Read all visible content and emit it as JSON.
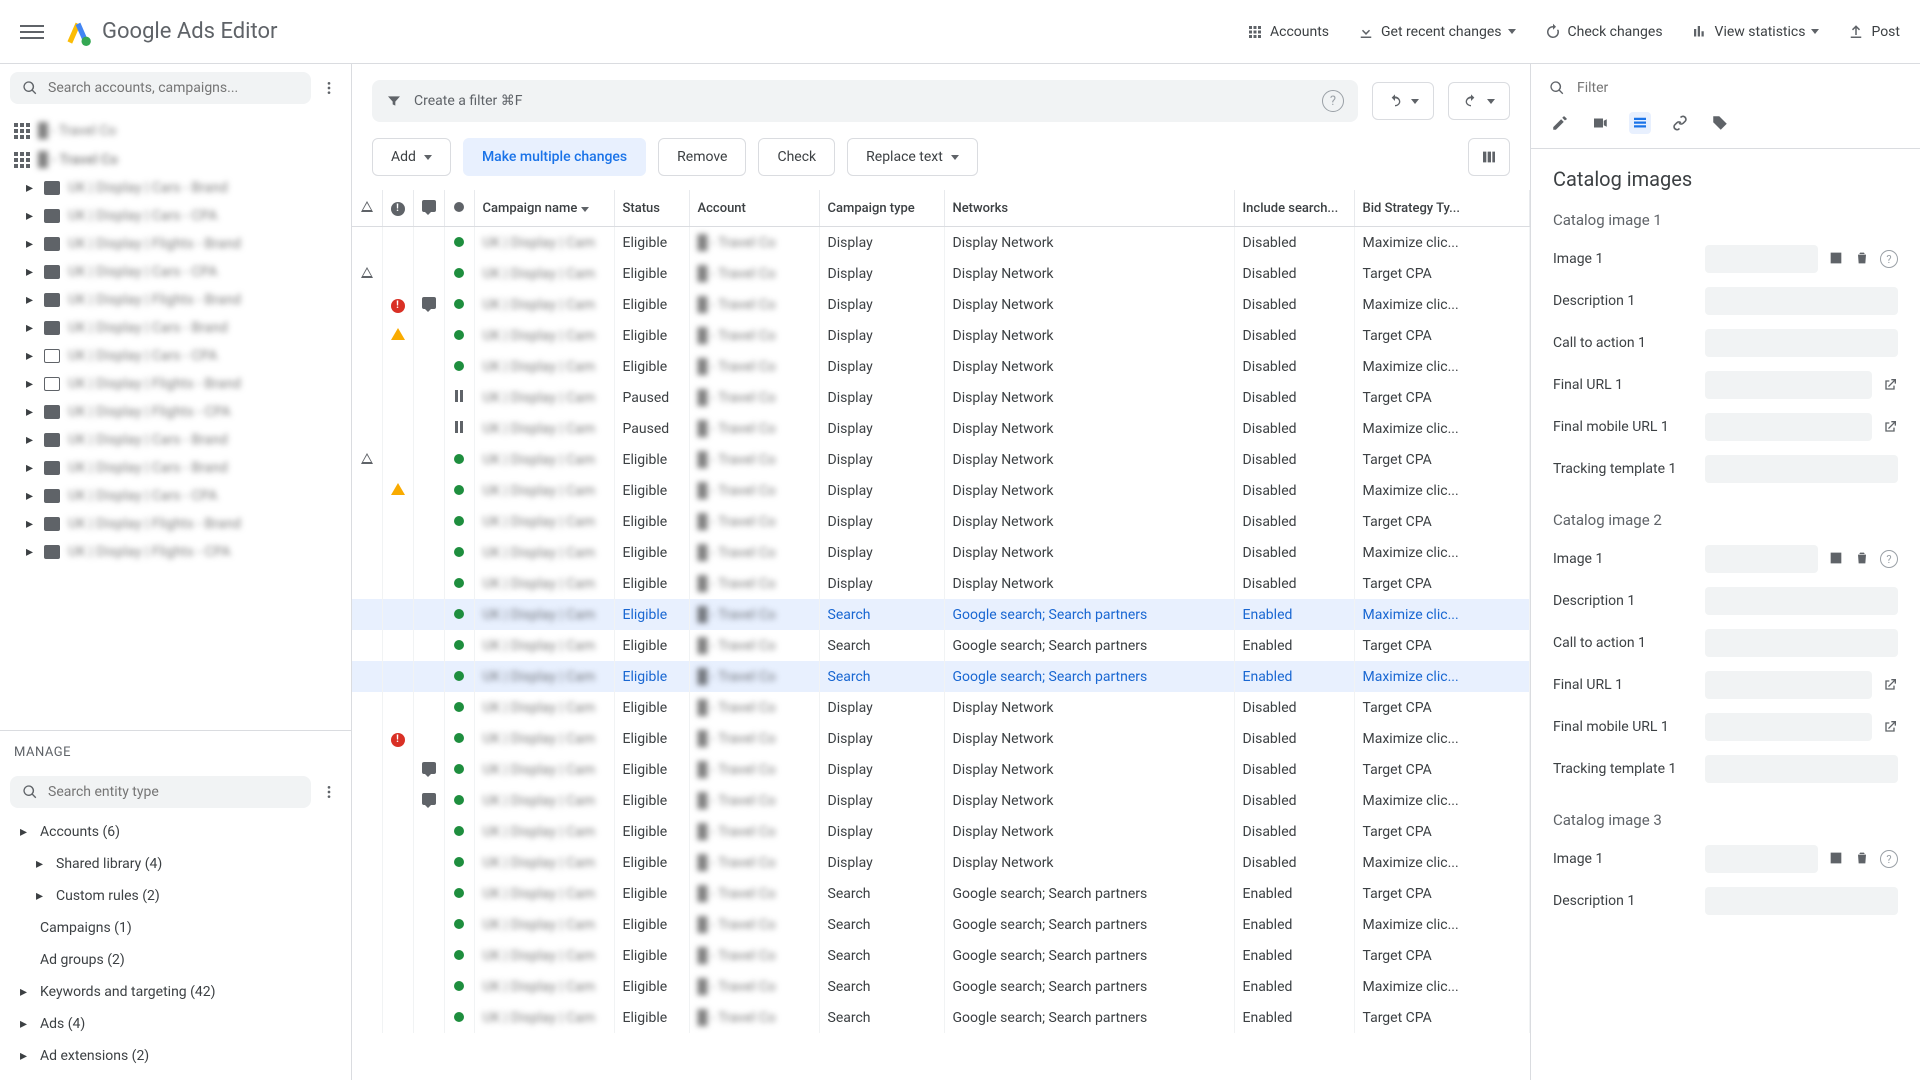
{
  "header": {
    "title": "Google Ads Editor",
    "accounts": "Accounts",
    "get_recent": "Get recent changes",
    "check_changes": "Check changes",
    "view_stats": "View statistics",
    "post": "Post"
  },
  "sidebar_left": {
    "search_placeholder": "Search accounts, campaigns...",
    "tree": [
      {
        "level": 1,
        "icon": "apps",
        "label": "█ - Travel Co"
      },
      {
        "level": 1,
        "icon": "apps",
        "label": "█ - Travel Co",
        "bold": true
      },
      {
        "level": 2,
        "icon": "folder",
        "label": "UK | Display | Cars - Brand"
      },
      {
        "level": 2,
        "icon": "folder",
        "label": "UK | Display | Cars - CPA"
      },
      {
        "level": 2,
        "icon": "folder",
        "label": "UK | Display | Flights - Brand"
      },
      {
        "level": 2,
        "icon": "folder",
        "label": "UK | Display | Cars - CPA"
      },
      {
        "level": 2,
        "icon": "folder",
        "label": "UK | Display | Flights - Brand"
      },
      {
        "level": 2,
        "icon": "folder",
        "label": "UK | Display | Cars - Brand"
      },
      {
        "level": 2,
        "icon": "folder-o",
        "label": "UK | Display | Cars - CPA"
      },
      {
        "level": 2,
        "icon": "folder-o",
        "label": "UK | Display | Flights - Brand"
      },
      {
        "level": 2,
        "icon": "folder",
        "label": "UK | Display | Flights - CPA"
      },
      {
        "level": 2,
        "icon": "folder",
        "label": "UK | Display | Cars - Brand"
      },
      {
        "level": 2,
        "icon": "folder",
        "label": "UK | Display | Cars - Brand"
      },
      {
        "level": 2,
        "icon": "folder",
        "label": "UK | Display | Cars - CPA"
      },
      {
        "level": 2,
        "icon": "folder",
        "label": "UK | Display | Flights - Brand"
      },
      {
        "level": 2,
        "icon": "folder",
        "label": "UK | Display | Flights - CPA"
      }
    ],
    "manage_label": "MANAGE",
    "manage_search_placeholder": "Search entity type",
    "manage_items": [
      {
        "label": "Accounts (6)",
        "caret": true
      },
      {
        "label": "Shared library (4)",
        "caret": true,
        "indent": true
      },
      {
        "label": "Custom rules (2)",
        "caret": true,
        "indent": true
      },
      {
        "label": "Campaigns (1)",
        "caret": false
      },
      {
        "label": "Ad groups (2)",
        "caret": false
      },
      {
        "label": "Keywords and targeting (42)",
        "caret": true
      },
      {
        "label": "Ads (4)",
        "caret": true
      },
      {
        "label": "Ad extensions (2)",
        "caret": true
      }
    ]
  },
  "center": {
    "filter_placeholder": "Create a filter  ⌘F",
    "add": "Add",
    "make_multiple": "Make multiple changes",
    "remove": "Remove",
    "check": "Check",
    "replace": "Replace text",
    "columns": {
      "campaign_name": "Campaign name",
      "status": "Status",
      "account": "Account",
      "campaign_type": "Campaign type",
      "networks": "Networks",
      "include_search": "Include search...",
      "bid_strategy": "Bid Strategy Ty..."
    },
    "rows": [
      {
        "tri": "",
        "alert": "",
        "comment": "",
        "dot": "green",
        "status": "Eligible",
        "type": "Display",
        "networks": "Display Network",
        "search": "Disabled",
        "bid": "Maximize clic..."
      },
      {
        "tri": "t",
        "alert": "",
        "comment": "",
        "dot": "green",
        "status": "Eligible",
        "type": "Display",
        "networks": "Display Network",
        "search": "Disabled",
        "bid": "Target CPA"
      },
      {
        "tri": "",
        "alert": "red",
        "comment": "c",
        "dot": "green",
        "status": "Eligible",
        "type": "Display",
        "networks": "Display Network",
        "search": "Disabled",
        "bid": "Maximize clic..."
      },
      {
        "tri": "",
        "alert": "yellow",
        "comment": "",
        "dot": "green",
        "status": "Eligible",
        "type": "Display",
        "networks": "Display Network",
        "search": "Disabled",
        "bid": "Target CPA"
      },
      {
        "tri": "",
        "alert": "",
        "comment": "",
        "dot": "green",
        "status": "Eligible",
        "type": "Display",
        "networks": "Display Network",
        "search": "Disabled",
        "bid": "Maximize clic..."
      },
      {
        "tri": "",
        "alert": "",
        "comment": "",
        "dot": "pause",
        "status": "Paused",
        "type": "Display",
        "networks": "Display Network",
        "search": "Disabled",
        "bid": "Target CPA"
      },
      {
        "tri": "",
        "alert": "",
        "comment": "",
        "dot": "pause",
        "status": "Paused",
        "type": "Display",
        "networks": "Display Network",
        "search": "Disabled",
        "bid": "Maximize clic..."
      },
      {
        "tri": "t",
        "alert": "",
        "comment": "",
        "dot": "green",
        "status": "Eligible",
        "type": "Display",
        "networks": "Display Network",
        "search": "Disabled",
        "bid": "Target CPA"
      },
      {
        "tri": "",
        "alert": "yellow",
        "comment": "",
        "dot": "green",
        "status": "Eligible",
        "type": "Display",
        "networks": "Display Network",
        "search": "Disabled",
        "bid": "Maximize clic..."
      },
      {
        "tri": "",
        "alert": "",
        "comment": "",
        "dot": "green",
        "status": "Eligible",
        "type": "Display",
        "networks": "Display Network",
        "search": "Disabled",
        "bid": "Target CPA"
      },
      {
        "tri": "",
        "alert": "",
        "comment": "",
        "dot": "green",
        "status": "Eligible",
        "type": "Display",
        "networks": "Display Network",
        "search": "Disabled",
        "bid": "Maximize clic..."
      },
      {
        "tri": "",
        "alert": "",
        "comment": "",
        "dot": "green",
        "status": "Eligible",
        "type": "Display",
        "networks": "Display Network",
        "search": "Disabled",
        "bid": "Target CPA"
      },
      {
        "tri": "",
        "alert": "",
        "comment": "",
        "dot": "green",
        "status": "Eligible",
        "type": "Search",
        "networks": "Google search; Search partners",
        "search": "Enabled",
        "bid": "Maximize clic...",
        "selected": true
      },
      {
        "tri": "",
        "alert": "",
        "comment": "",
        "dot": "green",
        "status": "Eligible",
        "type": "Search",
        "networks": "Google search; Search partners",
        "search": "Enabled",
        "bid": "Target CPA"
      },
      {
        "tri": "",
        "alert": "",
        "comment": "",
        "dot": "green",
        "status": "Eligible",
        "type": "Search",
        "networks": "Google search; Search partners",
        "search": "Enabled",
        "bid": "Maximize clic...",
        "selected": true
      },
      {
        "tri": "",
        "alert": "",
        "comment": "",
        "dot": "green",
        "status": "Eligible",
        "type": "Display",
        "networks": "Display Network",
        "search": "Disabled",
        "bid": "Target CPA"
      },
      {
        "tri": "",
        "alert": "red",
        "comment": "",
        "dot": "green",
        "status": "Eligible",
        "type": "Display",
        "networks": "Display Network",
        "search": "Disabled",
        "bid": "Maximize clic..."
      },
      {
        "tri": "",
        "alert": "",
        "comment": "c",
        "dot": "green",
        "status": "Eligible",
        "type": "Display",
        "networks": "Display Network",
        "search": "Disabled",
        "bid": "Target CPA"
      },
      {
        "tri": "",
        "alert": "",
        "comment": "c",
        "dot": "green",
        "status": "Eligible",
        "type": "Display",
        "networks": "Display Network",
        "search": "Disabled",
        "bid": "Maximize clic..."
      },
      {
        "tri": "",
        "alert": "",
        "comment": "",
        "dot": "green",
        "status": "Eligible",
        "type": "Display",
        "networks": "Display Network",
        "search": "Disabled",
        "bid": "Target CPA"
      },
      {
        "tri": "",
        "alert": "",
        "comment": "",
        "dot": "green",
        "status": "Eligible",
        "type": "Display",
        "networks": "Display Network",
        "search": "Disabled",
        "bid": "Maximize clic..."
      },
      {
        "tri": "",
        "alert": "",
        "comment": "",
        "dot": "green",
        "status": "Eligible",
        "type": "Search",
        "networks": "Google search; Search partners",
        "search": "Enabled",
        "bid": "Target CPA"
      },
      {
        "tri": "",
        "alert": "",
        "comment": "",
        "dot": "green",
        "status": "Eligible",
        "type": "Search",
        "networks": "Google search; Search partners",
        "search": "Enabled",
        "bid": "Maximize clic..."
      },
      {
        "tri": "",
        "alert": "",
        "comment": "",
        "dot": "green",
        "status": "Eligible",
        "type": "Search",
        "networks": "Google search; Search partners",
        "search": "Enabled",
        "bid": "Target CPA"
      },
      {
        "tri": "",
        "alert": "",
        "comment": "",
        "dot": "green",
        "status": "Eligible",
        "type": "Search",
        "networks": "Google search; Search partners",
        "search": "Enabled",
        "bid": "Maximize clic..."
      },
      {
        "tri": "",
        "alert": "",
        "comment": "",
        "dot": "green",
        "status": "Eligible",
        "type": "Search",
        "networks": "Google search; Search partners",
        "search": "Enabled",
        "bid": "Target CPA"
      }
    ]
  },
  "right": {
    "filter_placeholder": "Filter",
    "title": "Catalog images",
    "sections": [
      {
        "header": "Catalog image 1",
        "fields": [
          {
            "label": "Image 1",
            "icons": [
              "image",
              "trash",
              "help"
            ]
          },
          {
            "label": "Description 1"
          },
          {
            "label": "Call to action 1"
          },
          {
            "label": "Final URL 1",
            "icons": [
              "open"
            ]
          },
          {
            "label": "Final mobile URL 1",
            "icons": [
              "open"
            ]
          },
          {
            "label": "Tracking template 1"
          }
        ]
      },
      {
        "header": "Catalog image 2",
        "fields": [
          {
            "label": "Image 1",
            "icons": [
              "image",
              "trash",
              "help"
            ]
          },
          {
            "label": "Description 1"
          },
          {
            "label": "Call to action 1"
          },
          {
            "label": "Final URL 1",
            "icons": [
              "open"
            ]
          },
          {
            "label": "Final mobile URL 1",
            "icons": [
              "open"
            ]
          },
          {
            "label": "Tracking template 1"
          }
        ]
      },
      {
        "header": "Catalog image 3",
        "fields": [
          {
            "label": "Image 1",
            "icons": [
              "image",
              "trash",
              "help"
            ]
          },
          {
            "label": "Description 1"
          }
        ]
      }
    ]
  }
}
